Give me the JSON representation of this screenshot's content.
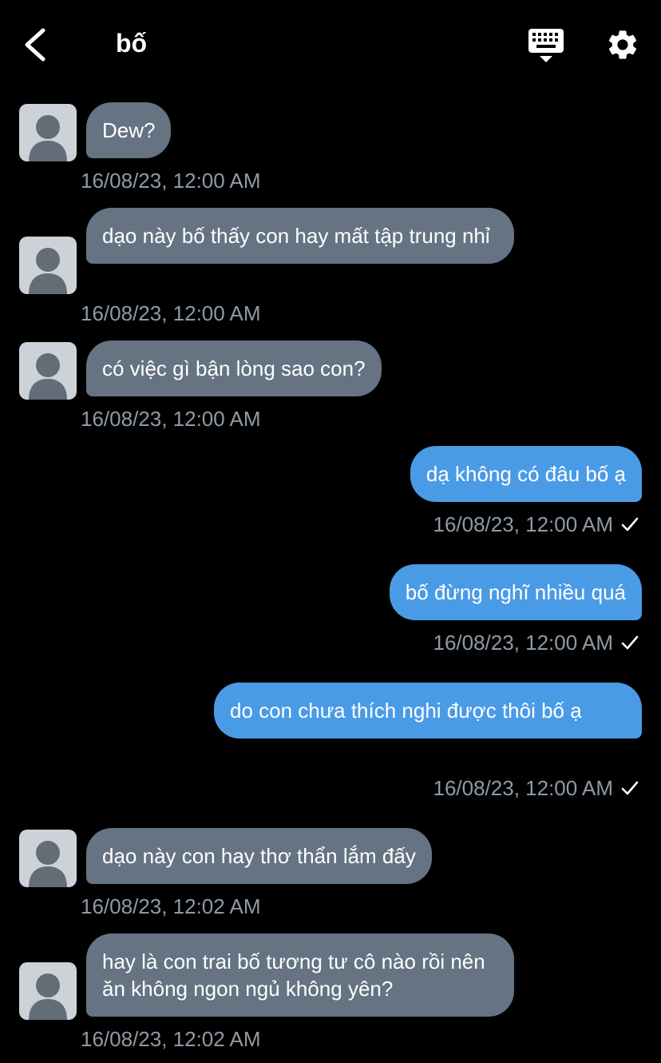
{
  "header": {
    "title": "bố",
    "back_icon": "chevron-left-icon",
    "keyboard_icon": "keyboard-icon",
    "settings_icon": "gear-icon"
  },
  "colors": {
    "background": "#000000",
    "incoming_bubble": "#657382",
    "outgoing_bubble": "#4a9be6",
    "timestamp": "#8f9aa6"
  },
  "messages": [
    {
      "direction": "in",
      "text": "Dew?",
      "time": "16/08/23, 12:00 AM"
    },
    {
      "direction": "in",
      "text": "dạo này bố thấy con hay mất tập trung nhỉ",
      "time": "16/08/23, 12:00 AM"
    },
    {
      "direction": "in",
      "text": "có việc gì bận lòng sao con?",
      "time": "16/08/23, 12:00 AM"
    },
    {
      "direction": "out",
      "text": "dạ không có đâu bố ạ",
      "time": "16/08/23, 12:00 AM",
      "status_icon": "checkmark-icon"
    },
    {
      "direction": "out",
      "text": "bố đừng nghĩ nhiều quá",
      "time": "16/08/23, 12:00 AM",
      "status_icon": "checkmark-icon"
    },
    {
      "direction": "out",
      "text": "do con chưa thích nghi được thôi bố ạ",
      "time": "16/08/23, 12:00 AM",
      "status_icon": "checkmark-icon"
    },
    {
      "direction": "in",
      "text": "dạo này con hay thơ thẩn lắm đấy",
      "time": "16/08/23, 12:02 AM"
    },
    {
      "direction": "in",
      "text": "hay là con trai bố tương tư cô nào rồi nên ăn không ngon ngủ không yên?",
      "time": "16/08/23, 12:02 AM"
    }
  ]
}
